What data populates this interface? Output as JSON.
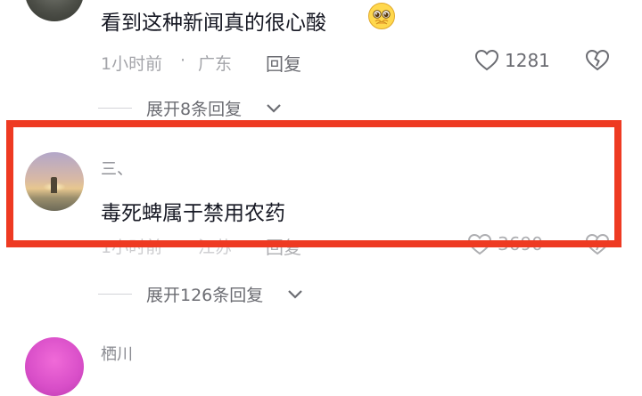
{
  "comments": [
    {
      "text": "看到这种新闻真的很心酸",
      "emoji_icon": "pleading-face-emoji",
      "time": "1小时前",
      "separator": "·",
      "location": "广东",
      "reply_label": "回复",
      "likes": "1281",
      "expand_label": "展开8条回复"
    },
    {
      "username": "三、",
      "text": "毒死蜱属于禁用农药",
      "time": "1小时前",
      "location": "江苏",
      "reply_label": "回复",
      "likes": "3690"
    },
    {
      "expand_label": "展开126条回复"
    },
    {
      "username": "栖川"
    }
  ],
  "colors": {
    "highlight_border": "#ee3a22",
    "primary_text": "#161823",
    "secondary_text": "#a3a4a9"
  }
}
